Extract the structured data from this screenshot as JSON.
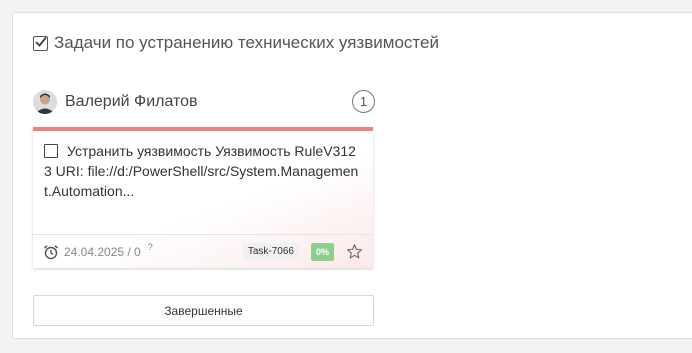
{
  "section": {
    "title": "Задачи по устранению технических уязвимостей",
    "checked": true
  },
  "user": {
    "name": "Валерий Филатов",
    "task_count": "1"
  },
  "task": {
    "title": "Устранить уязвимость Уязвимость RuleV3123 URI: file://d:/PowerShell/src/System.Management.Automation...",
    "date": "24.04.2025 / 0",
    "help_mark": "?",
    "id": "Task-7066",
    "progress": "0%",
    "accent_color": "#e98583",
    "icons": [
      "alarm-clock-icon",
      "star-icon"
    ]
  },
  "footer": {
    "completed_label": "Завершенные"
  }
}
